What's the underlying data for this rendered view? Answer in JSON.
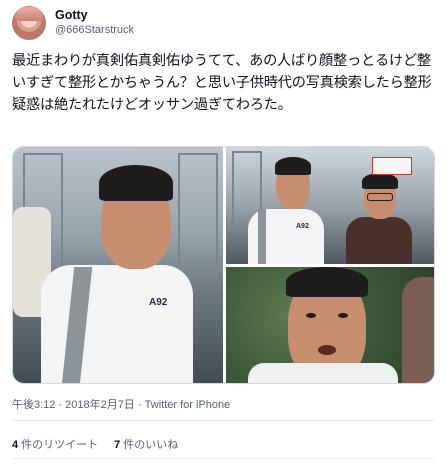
{
  "user": {
    "display_name": "Gotty",
    "handle": "@666Starstruck"
  },
  "tweet": {
    "text": "最近まわりが真剣佑真剣佑ゆうてて、あの人ばり顔整っとるけど整いすぎて整形とかちゃうん？と思い子供時代の写真検索したら整形疑惑は絶たれたけどオッサン過ぎてわろた。",
    "timestamp": "午後3:12 · 2018年2月7日 · Twitter for iPhone"
  },
  "media": {
    "shirt_print_1": "A92",
    "shirt_print_2": "A92"
  },
  "stats": {
    "retweets_count": "4",
    "retweets_label": "件のリツイート",
    "likes_count": "7",
    "likes_label": "件のいいね"
  },
  "colors": {
    "text_primary": "#0f1419",
    "text_secondary": "#536471",
    "border": "#cfd9de"
  }
}
